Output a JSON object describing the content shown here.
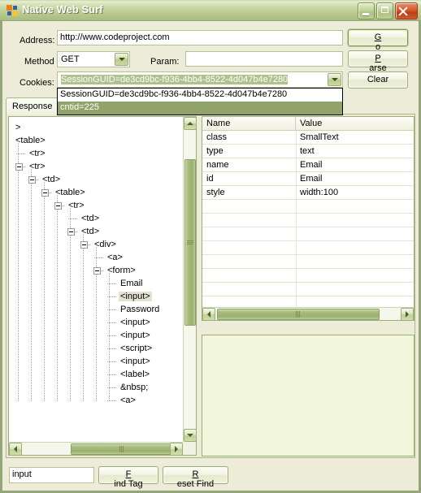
{
  "window": {
    "title": "Native Web Surf",
    "icon": "windows-forms-app-icon",
    "minimize_label": "Minimize",
    "maximize_label": "Maximize",
    "close_label": "Close"
  },
  "form": {
    "address_label": "Address:",
    "address_value": "http://www.codeproject.com",
    "method_label": "Method",
    "method_value": "GET",
    "param_label": "Param:",
    "param_value": "",
    "cookies_label": "Cookies:",
    "cookies_value": "SessionGUID=de3cd9bc-f936-4bb4-8522-4d047b4e7280",
    "cookies_options": [
      "SessionGUID=de3cd9bc-f936-4bb4-8522-4d047b4e7280",
      "cntid=225"
    ],
    "cookies_selected_index": 1,
    "dropdown_open": true
  },
  "buttons": {
    "go": "Go",
    "go_accel": "G",
    "parse": "Parse",
    "parse_accel": "P",
    "clear": "Clear",
    "find_tag": "Find Tag",
    "find_tag_accel": "F",
    "reset_find": "Reset Find",
    "reset_find_accel": "R"
  },
  "tabs": [
    {
      "label": "Response",
      "active": true
    }
  ],
  "tree": {
    "truncated_top_label": ">",
    "nodes": [
      {
        "label": "<table>",
        "depth": 0,
        "expander": "none",
        "selected": false
      },
      {
        "label": "<tr>",
        "depth": 1,
        "expander": "none",
        "selected": false
      },
      {
        "label": "<tr>",
        "depth": 1,
        "expander": "minus",
        "selected": false
      },
      {
        "label": "<td>",
        "depth": 2,
        "expander": "minus",
        "selected": false
      },
      {
        "label": "<table>",
        "depth": 3,
        "expander": "minus",
        "selected": false
      },
      {
        "label": "<tr>",
        "depth": 4,
        "expander": "minus",
        "selected": false
      },
      {
        "label": "<td>",
        "depth": 5,
        "expander": "none",
        "selected": false
      },
      {
        "label": "<td>",
        "depth": 5,
        "expander": "minus",
        "selected": false
      },
      {
        "label": "<div>",
        "depth": 6,
        "expander": "minus",
        "selected": false
      },
      {
        "label": "<a>",
        "depth": 7,
        "expander": "none",
        "selected": false
      },
      {
        "label": "<form>",
        "depth": 7,
        "expander": "minus",
        "selected": false
      },
      {
        "label": "Email",
        "depth": 8,
        "expander": "none",
        "selected": false
      },
      {
        "label": "<input>",
        "depth": 8,
        "expander": "none",
        "selected": true
      },
      {
        "label": "Password",
        "depth": 8,
        "expander": "none",
        "selected": false
      },
      {
        "label": "<input>",
        "depth": 8,
        "expander": "none",
        "selected": false
      },
      {
        "label": "<input>",
        "depth": 8,
        "expander": "none",
        "selected": false
      },
      {
        "label": "<script>",
        "depth": 8,
        "expander": "none",
        "selected": false
      },
      {
        "label": "<input>",
        "depth": 8,
        "expander": "none",
        "selected": false
      },
      {
        "label": "<label>",
        "depth": 8,
        "expander": "none",
        "selected": false
      },
      {
        "label": "&nbsp;",
        "depth": 8,
        "expander": "none",
        "selected": false
      },
      {
        "label": "<a>",
        "depth": 8,
        "expander": "none",
        "selected": false
      }
    ]
  },
  "properties": {
    "columns": [
      "Name",
      "Value"
    ],
    "rows": [
      {
        "name": "class",
        "value": "SmallText"
      },
      {
        "name": "type",
        "value": "text"
      },
      {
        "name": "name",
        "value": "Email"
      },
      {
        "name": "id",
        "value": "Email"
      },
      {
        "name": "style",
        "value": "width:100"
      }
    ],
    "empty_row_count": 12
  },
  "find": {
    "input_value": "input",
    "input_placeholder": ""
  },
  "output": {
    "text": ""
  },
  "colors": {
    "accent": "#94A67A",
    "titlebar": "#B5C78C",
    "form_background": "#ECECD8",
    "field_background": "#FFFFFF",
    "output_background": "#F2F7DC",
    "selection": "#8FA36B",
    "close_button": "#C4441B"
  }
}
